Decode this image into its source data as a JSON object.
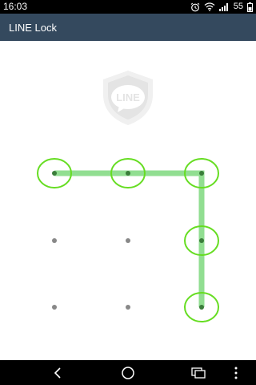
{
  "status_bar": {
    "time": "16:03",
    "battery_level": "55",
    "icons": [
      "alarm-icon",
      "wifi-icon",
      "signal-icon",
      "battery-icon"
    ]
  },
  "action_bar": {
    "title": "LINE Lock"
  },
  "logo": {
    "text": "LINE",
    "icon": "line-shield-logo"
  },
  "pattern_lock": {
    "grid_size": 3,
    "dots": [
      {
        "row": 0,
        "col": 0,
        "selected": true
      },
      {
        "row": 0,
        "col": 1,
        "selected": true
      },
      {
        "row": 0,
        "col": 2,
        "selected": true
      },
      {
        "row": 1,
        "col": 0,
        "selected": false
      },
      {
        "row": 1,
        "col": 1,
        "selected": false
      },
      {
        "row": 1,
        "col": 2,
        "selected": true
      },
      {
        "row": 2,
        "col": 0,
        "selected": false
      },
      {
        "row": 2,
        "col": 1,
        "selected": false
      },
      {
        "row": 2,
        "col": 2,
        "selected": true
      }
    ],
    "path_order": [
      [
        0,
        0
      ],
      [
        0,
        1
      ],
      [
        0,
        2
      ],
      [
        1,
        2
      ],
      [
        2,
        2
      ]
    ],
    "colors": {
      "path": "#7ed87e",
      "ring": "#66dd22",
      "dot": "#888888",
      "dot_selected": "#3a7d3a"
    }
  },
  "nav_bar": {
    "buttons": [
      "back-icon",
      "home-icon",
      "recents-icon",
      "menu-icon"
    ]
  }
}
